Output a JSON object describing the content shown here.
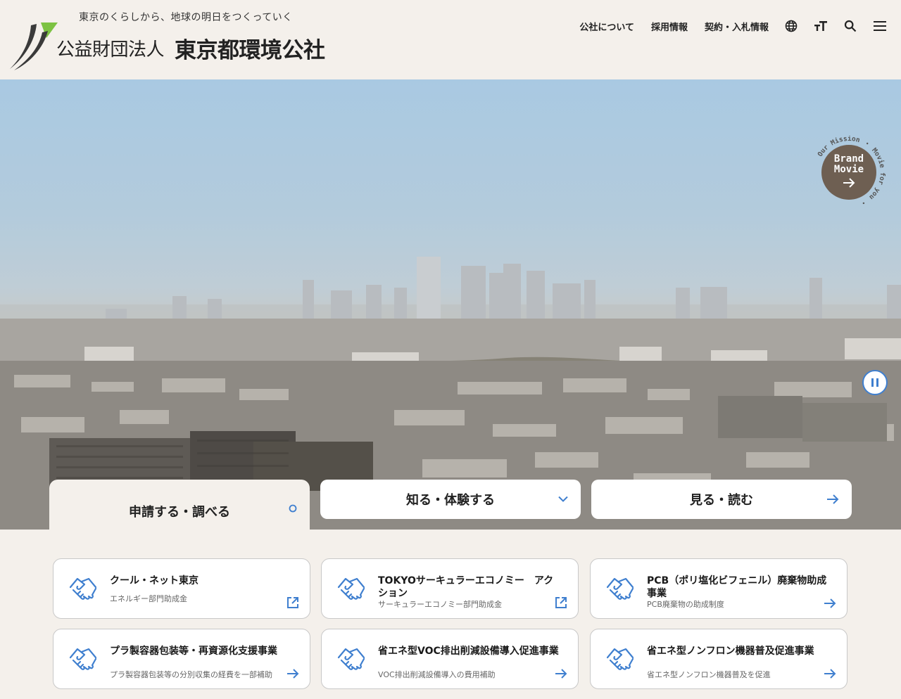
{
  "header": {
    "tagline": "東京のくらしから、地球の明日をつくっていく",
    "org_type": "公益財団法人",
    "org_name": "東京都環境公社",
    "nav": [
      {
        "label": "公社について"
      },
      {
        "label": "採用情報"
      },
      {
        "label": "契約・入札情報"
      }
    ],
    "icons": [
      "globe-icon",
      "text-size-icon",
      "search-icon",
      "menu-icon"
    ]
  },
  "hero": {
    "brand_movie": {
      "label_line1": "Brand",
      "label_line2": "Movie",
      "ring_text": "Our Mission ・ Movie for you ・"
    },
    "pause_icon": "pause-icon"
  },
  "tabs": [
    {
      "label": "申請する・調べる",
      "icon": "circle-icon",
      "active": true
    },
    {
      "label": "知る・体験する",
      "icon": "chevron-down-icon",
      "active": false
    },
    {
      "label": "見る・読む",
      "icon": "arrow-right-icon",
      "active": false
    }
  ],
  "cards": [
    {
      "title": "クール・ネット東京",
      "subtitle": "エネルギー部門助成金",
      "icon": "handshake-icon",
      "action_icon": "external-link-icon"
    },
    {
      "title": "TOKYOサーキュラーエコノミー　アクション",
      "subtitle": "サーキュラーエコノミー部門助成金",
      "icon": "handshake-icon",
      "action_icon": "external-link-icon"
    },
    {
      "title": "PCB（ポリ塩化ビフェニル）廃棄物助成事業",
      "subtitle": "PCB廃棄物の助成制度",
      "icon": "handshake-icon",
      "action_icon": "arrow-right-icon"
    },
    {
      "title": "プラ製容器包装等・再資源化支援事業",
      "subtitle": "プラ製容器包装等の分別収集の経費を一部補助",
      "icon": "handshake-icon",
      "action_icon": "arrow-right-icon"
    },
    {
      "title": "省エネ型VOC排出削減設備導入促進事業",
      "subtitle": "VOC排出削減設備導入の費用補助",
      "icon": "handshake-icon",
      "action_icon": "arrow-right-icon"
    },
    {
      "title": "省エネ型ノンフロン機器普及促進事業",
      "subtitle": "省エネ型ノンフロン機器普及を促進",
      "icon": "handshake-icon",
      "action_icon": "arrow-right-icon"
    }
  ],
  "colors": {
    "background": "#f4f0eb",
    "accent_blue": "#3f7fcf",
    "brand_green": "#7cc242",
    "brand_dark": "#3a3a3a",
    "brand_movie": "#6e5f52"
  }
}
